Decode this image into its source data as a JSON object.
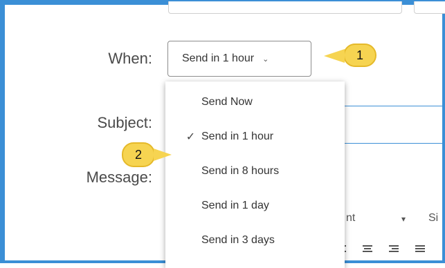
{
  "form": {
    "when_label": "When:",
    "subject_label": "Subject:",
    "message_label": "Message:",
    "when_value": "Send in 1 hour"
  },
  "dropdown": {
    "items": [
      {
        "label": "Send Now",
        "selected": false
      },
      {
        "label": "Send in 1 hour",
        "selected": true
      },
      {
        "label": "Send in 8 hours",
        "selected": false
      },
      {
        "label": "Send in 1 day",
        "selected": false
      },
      {
        "label": "Send in 3 days",
        "selected": false
      }
    ]
  },
  "toolbar": {
    "font_partial": "nt",
    "size_partial": "Si"
  },
  "callouts": [
    "1",
    "2"
  ],
  "colors": {
    "frame_border": "#3b8fd6",
    "callout_fill": "#f6d451"
  },
  "icons": {
    "chevron": "chevron-down-icon",
    "check": "check-icon"
  }
}
